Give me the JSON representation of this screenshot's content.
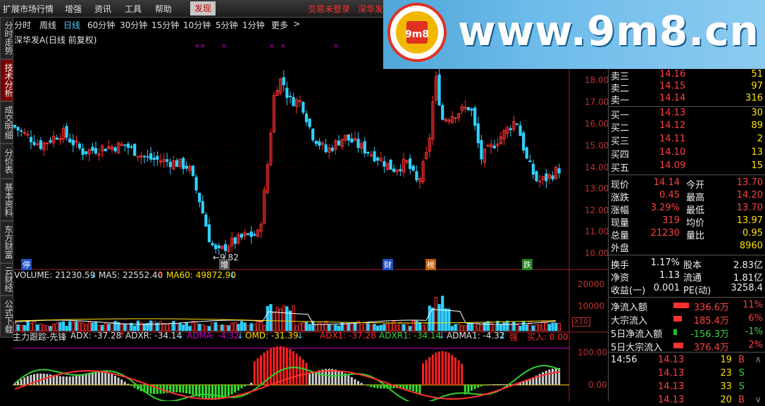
{
  "menubar": {
    "items": [
      "扩展市场行情",
      "增强",
      "资讯",
      "工具",
      "帮助"
    ],
    "active_item": "发现",
    "status_text": "交易未登录",
    "stock_short": "深华发"
  },
  "periods": {
    "items": [
      "分时",
      "周线",
      "日线",
      "60分钟",
      "30分钟",
      "15分钟",
      "10分钟",
      "5分钟",
      "1分钟",
      "更多"
    ],
    "active": "日线",
    "more_arrow": ">"
  },
  "left_tabs": [
    "分时走势",
    "技术分析",
    "成交明细",
    "分价表",
    "基本资料",
    "东方财富",
    "云财经",
    "公式下载"
  ],
  "left_tab_active": "技术分析",
  "chart_header": {
    "title": "深华发A(日线 前复权)"
  },
  "price_axis": [
    "18.00",
    "17.00",
    "16.00",
    "15.00",
    "14.00",
    "13.00",
    "12.00",
    "11.00",
    "10.00"
  ],
  "low_marker": "9.82",
  "event_tags": [
    {
      "label": "增",
      "color": "#c0c0c0"
    },
    {
      "label": "财",
      "color": "#4080ff"
    },
    {
      "label": "榜",
      "color": "#ff8000"
    },
    {
      "label": "跌",
      "color": "#40c040"
    },
    {
      "label": "停",
      "color": "#4080ff"
    }
  ],
  "volume_legend": {
    "volume": "VOLUME: 21230.59",
    "ma5": "MA5: 22552.40",
    "ma60": "MA60: 49872.90"
  },
  "volume_axis": [
    "20000",
    "10000"
  ],
  "volume_unit": "X10",
  "indicator_legend": {
    "name": "主力跟踪-先锋",
    "adx": "ADX: -37.28",
    "adxr": "ADXR: -34.14",
    "adma": "ADMA: -4.32",
    "omd": "OMD: -31.39",
    "adx1": "ADX1: -37.28",
    "adxr1": "ADXR1: -34.14",
    "adma1": "ADMA1: -4.32",
    "strong": "强",
    "buy": "买入: 0.00"
  },
  "indicator_axis": [
    "100.00",
    "0.00"
  ],
  "order_book": {
    "sells": [
      {
        "label": "卖三",
        "price": "14.16",
        "vol": "51"
      },
      {
        "label": "卖二",
        "price": "14.15",
        "vol": "97"
      },
      {
        "label": "卖一",
        "price": "14.14",
        "vol": "316"
      }
    ],
    "buys": [
      {
        "label": "买一",
        "price": "14.13",
        "vol": "30"
      },
      {
        "label": "买二",
        "price": "14.12",
        "vol": "89"
      },
      {
        "label": "买三",
        "price": "14.11",
        "vol": "2"
      },
      {
        "label": "买四",
        "price": "14.10",
        "vol": "13"
      },
      {
        "label": "买五",
        "price": "14.09",
        "vol": "15"
      }
    ]
  },
  "quote": [
    {
      "l1": "现价",
      "v1": "14.14",
      "l2": "今开",
      "v2": "13.70"
    },
    {
      "l1": "涨跌",
      "v1": "0.45",
      "l2": "最高",
      "v2": "14.20"
    },
    {
      "l1": "涨幅",
      "v1": "3.29%",
      "l2": "最低",
      "v2": "13.70"
    },
    {
      "l1": "现量",
      "v1": "319",
      "l2": "均价",
      "v2": "13.97"
    },
    {
      "l1": "总量",
      "v1": "21230",
      "l2": "量比",
      "v2": "0.95"
    },
    {
      "l1": "外盘",
      "v1": "",
      "l2": "",
      "v2": "8960"
    }
  ],
  "fundamentals": [
    {
      "l1": "换手",
      "v1": "1.17%",
      "l2": "股本",
      "v2": "2.83亿"
    },
    {
      "l1": "净资",
      "v1": "1.13",
      "l2": "流通",
      "v2": "1.81亿"
    },
    {
      "l1": "收益(一)",
      "v1": "0.001",
      "l2": "PE(动)",
      "v2": "3258.4"
    }
  ],
  "flows": [
    {
      "label": "净流入额",
      "value": "336.6万",
      "pct": "11%",
      "color": "#ff3030",
      "share": 0.9
    },
    {
      "label": "大宗流入",
      "value": "185.4万",
      "pct": "6%",
      "color": "#ff3030",
      "share": 0.5
    },
    {
      "label": "5日净流入额",
      "value": "-156.3万",
      "pct": "-1%",
      "color": "#20c020",
      "share": 0.2
    },
    {
      "label": "5日大宗流入",
      "value": "376.4万",
      "pct": "2%",
      "color": "#ff3030",
      "share": 0.6
    }
  ],
  "ticks": [
    {
      "time": "14:56",
      "price": "14.13",
      "vol": "19",
      "side": "B"
    },
    {
      "time": "",
      "price": "14.13",
      "vol": "23",
      "side": "S"
    },
    {
      "time": "",
      "price": "14.13",
      "vol": "33",
      "side": "S"
    },
    {
      "time": "",
      "price": "14.13",
      "vol": "20",
      "side": "B"
    }
  ],
  "watermark": {
    "text": "www.9m8.cn",
    "seal": "9m8",
    "seal_url": "www.9m8.cn"
  },
  "colors": {
    "up": "#ff3030",
    "down": "#30d0ff",
    "ma": "#e0e0e0"
  }
}
